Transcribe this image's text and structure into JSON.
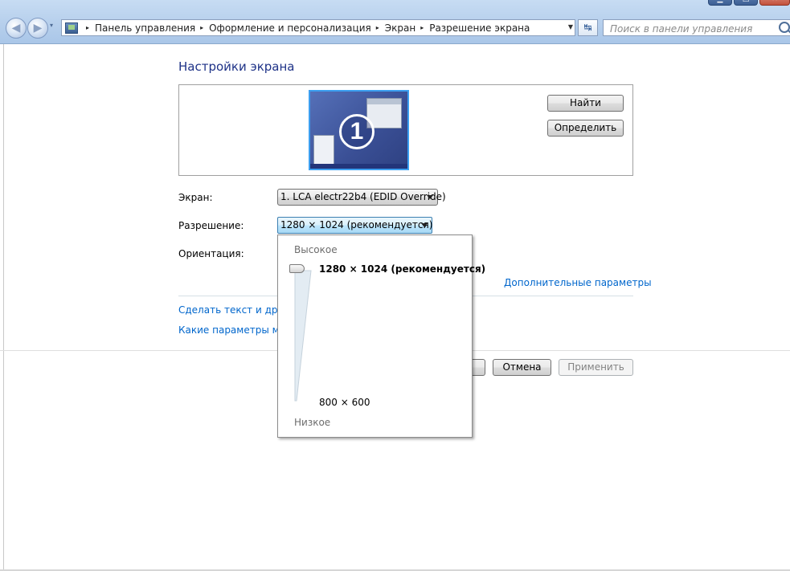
{
  "window": {
    "minimize_glyph": "▁",
    "maximize_glyph": "□",
    "close_glyph": "✕"
  },
  "nav": {
    "back_glyph": "◀",
    "forward_glyph": "▶",
    "history_glyph": "▾"
  },
  "breadcrumb": {
    "items": [
      "Панель управления",
      "Оформление и персонализация",
      "Экран",
      "Разрешение экрана"
    ],
    "separator": "▸",
    "dropdown_glyph": "▼",
    "refresh_glyph": "↹"
  },
  "search": {
    "placeholder": "Поиск в панели управления",
    "icon": "search-icon"
  },
  "page": {
    "title": "Настройки экрана"
  },
  "monitor": {
    "number": "1"
  },
  "buttons": {
    "find": "Найти",
    "identify": "Определить",
    "ok": "",
    "cancel": "Отмена",
    "apply": "Применить"
  },
  "fields": {
    "screen_label": "Экран:",
    "screen_value": "1. LCA electr22b4 (EDID Override)",
    "resolution_label": "Разрешение:",
    "resolution_value": "1280 × 1024 (рекомендуется)",
    "orientation_label": "Ориентация:"
  },
  "links": {
    "advanced": "Дополнительные параметры",
    "text_size": "Сделать текст и други",
    "which_params": "Какие параметры мон"
  },
  "resolution_popup": {
    "high_label": "Высокое",
    "low_label": "Низкое",
    "top_value": "1280 × 1024 (рекомендуется)",
    "bottom_value": "800 × 600",
    "slider_level": 1.0
  },
  "colors": {
    "accent_link": "#0066cc",
    "title": "#1e3287",
    "monitor_border": "#3c9ff0"
  }
}
